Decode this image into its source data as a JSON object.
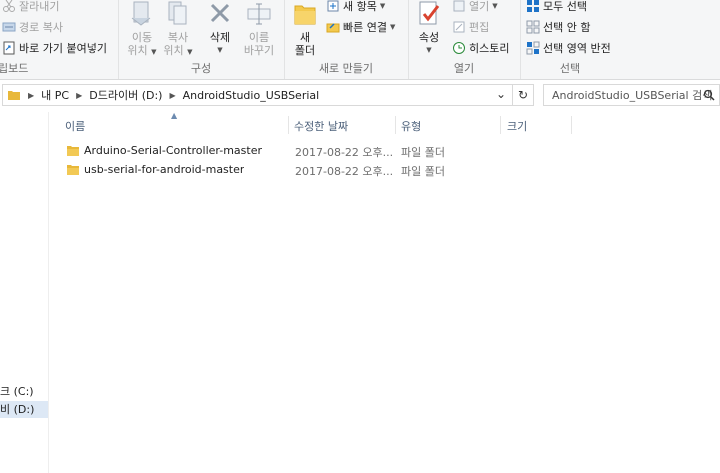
{
  "ribbon": {
    "clipboard": {
      "cut": "잘라내기",
      "copy_path": "경로 복사",
      "paste_shortcut": "바로 가기 붙여넣기",
      "label": "립보드"
    },
    "organize": {
      "move_to": "이동",
      "move_to2": "위치",
      "copy_to": "복사",
      "copy_to2": "위치",
      "delete": "삭제",
      "rename": "이름",
      "rename2": "바꾸기",
      "label": "구성"
    },
    "new": {
      "new_folder": "새",
      "new_folder2": "폴더",
      "new_item": "새 항목",
      "easy_access": "빠른 연결",
      "label": "새로 만들기"
    },
    "open": {
      "properties": "속성",
      "open": "열기",
      "edit": "편집",
      "history": "히스토리",
      "label": "열기"
    },
    "select": {
      "select_all": "모두 선택",
      "select_none": "선택 안 함",
      "invert": "선택 영역 반전",
      "label": "선택"
    }
  },
  "address": {
    "crumbs": [
      "내 PC",
      "D드라이버 (D:)",
      "AndroidStudio_USBSerial"
    ],
    "search_placeholder": "AndroidStudio_USBSerial 검색"
  },
  "nav": {
    "drive_c": "크 (C:)",
    "drive_d": "비 (D:)"
  },
  "columns": {
    "name": "이름",
    "modified": "수정한 날짜",
    "type": "유형",
    "size": "크기"
  },
  "files": [
    {
      "name": "Arduino-Serial-Controller-master",
      "modified": "2017-08-22 오후...",
      "type": "파일 폴더",
      "size": ""
    },
    {
      "name": "usb-serial-for-android-master",
      "modified": "2017-08-22 오후...",
      "type": "파일 폴더",
      "size": ""
    }
  ],
  "colors": {
    "folder": "#e8b83a",
    "accent_blue": "#1e73c8",
    "selected_nav": "#dde8f5"
  }
}
